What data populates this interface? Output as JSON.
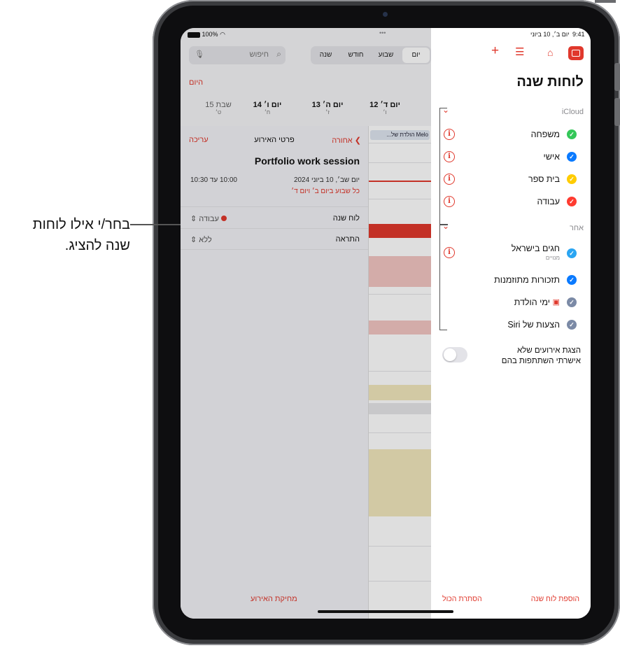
{
  "callout": {
    "line1": "בחר/י אילו לוחות",
    "line2": "שנה להציג."
  },
  "status": {
    "battery": "100%",
    "time": "9:41",
    "date": "יום ב׳, 10 ביוני",
    "dots": "•••"
  },
  "search": {
    "placeholder": "חיפוש"
  },
  "view_segments": [
    "שנה",
    "חודש",
    "שבוע",
    "יום"
  ],
  "today_label": "היום",
  "week_days": [
    {
      "name": "יום ד׳ 12",
      "sub": "ו׳"
    },
    {
      "name": "יום ה׳ 13",
      "sub": "ז׳"
    },
    {
      "name": "יום ו׳ 14",
      "sub": "ח׳"
    },
    {
      "name": "שבת 15",
      "sub": "ט׳"
    }
  ],
  "event_detail": {
    "back_label": "אחורה",
    "header": "פרטי האירוע",
    "edit_label": "עריכה",
    "title": "Portfolio work session",
    "date": "יום שב׳, 10 ביוני 2024",
    "time": "10:00 עד 10:30",
    "repeat": "כל שבוע ביום ב׳ ויום ד׳",
    "calendar_label": "לוח שנה",
    "calendar_value": "עבודה",
    "alert_label": "התראה",
    "alert_value": "ללא",
    "delete_label": "מחיקת האירוע",
    "birthday_event": "...הולדת של Melo"
  },
  "panel": {
    "title": "לוחות שנה",
    "group1": "iCloud",
    "group2": "אחר",
    "calendars_icloud": [
      {
        "name": "משפחה",
        "color": "#34c759"
      },
      {
        "name": "אישי",
        "color": "#0a7aff"
      },
      {
        "name": "בית ספר",
        "color": "#ffcc00"
      },
      {
        "name": "עבודה",
        "color": "#ff3b30"
      }
    ],
    "calendars_other": [
      {
        "name": "חגים בישראל",
        "sub": "מנויים",
        "color": "#2aa5f2"
      },
      {
        "name": "תזכורות מתוזמנות",
        "color": "#0a7aff"
      },
      {
        "name": "ימי הולדת",
        "color": "#7b8aa6"
      },
      {
        "name": "הצעות של Siri",
        "color": "#7b8aa6"
      }
    ],
    "toggle_line1": "הצגת אירועים שלא",
    "toggle_line2": "אישרתי השתתפות בהם",
    "add_calendar": "הוספת לוח שנה",
    "hide_all": "הסתרת הכול"
  }
}
